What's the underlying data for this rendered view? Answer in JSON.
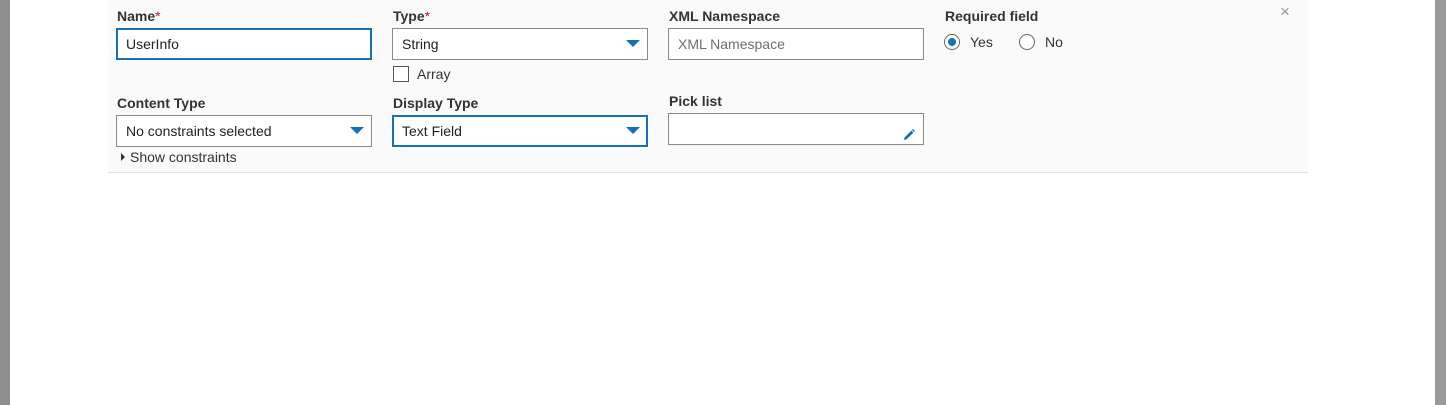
{
  "form": {
    "name": {
      "label": "Name",
      "required_mark": "*",
      "value": "UserInfo"
    },
    "type": {
      "label": "Type",
      "required_mark": "*",
      "selected": "String",
      "array_label": "Array",
      "array_checked": false
    },
    "xml_namespace": {
      "label": "XML Namespace",
      "placeholder": "XML Namespace",
      "value": ""
    },
    "required_field": {
      "label": "Required field",
      "options": [
        "Yes",
        "No"
      ],
      "selected": "Yes"
    },
    "content_type": {
      "label": "Content Type",
      "selected": "No constraints selected",
      "toggle_label": "Show constraints"
    },
    "display_type": {
      "label": "Display Type",
      "selected": "Text Field"
    },
    "pick_list": {
      "label": "Pick list",
      "value": ""
    },
    "close_symbol": "×"
  },
  "icons": {
    "edit": "pencil-icon",
    "close": "close-icon",
    "dropdown": "chevron-down-icon",
    "expand": "caret-right-icon"
  },
  "colors": {
    "accent": "#1670b4",
    "required": "#c8102e"
  }
}
